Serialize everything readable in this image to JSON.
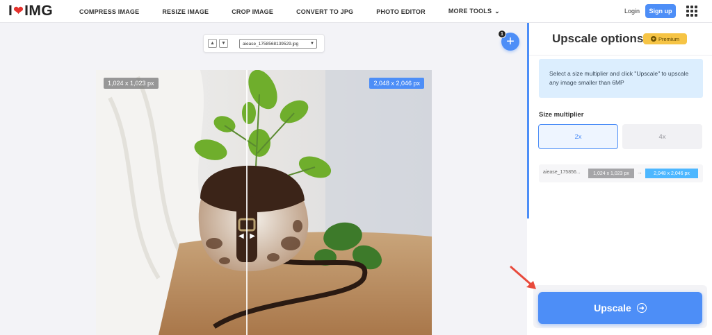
{
  "header": {
    "logo_left": "I",
    "logo_right": "IMG",
    "nav": [
      "COMPRESS IMAGE",
      "RESIZE IMAGE",
      "CROP IMAGE",
      "CONVERT TO JPG",
      "PHOTO EDITOR",
      "MORE TOOLS"
    ],
    "login": "Login",
    "signup": "Sign up"
  },
  "workspace": {
    "file_name": "aiease_1758568139529.jpg",
    "file_count": "1",
    "size_before": "1,024 x 1,023 px",
    "size_after": "2,048 x 2,046 px"
  },
  "panel": {
    "title": "Upscale options",
    "badge": "Premium",
    "info": "Select a size multiplier and click \"Upscale\" to upscale any image smaller than 6MP",
    "multiplier_label": "Size multiplier",
    "options": [
      "2x",
      "4x"
    ],
    "selected_option": "2x",
    "file_row": {
      "name": "aiease_175856...",
      "before": "1,024 x 1,023 px",
      "after": "2,048 x 2,046 px"
    },
    "upscale_button": "Upscale"
  },
  "colors": {
    "accent": "#4d8ef7",
    "brand_red": "#e5322d",
    "premium": "#f6c445",
    "annotation_arrow": "#e84a3c"
  }
}
